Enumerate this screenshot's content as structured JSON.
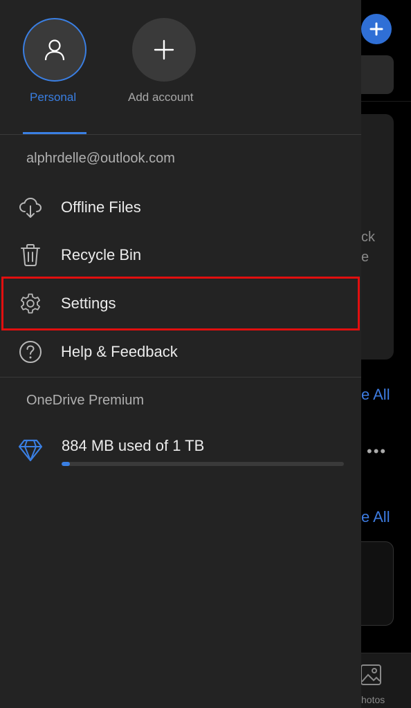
{
  "background": {
    "card_text_line1": "ck",
    "card_text_line2": "e",
    "see_all_1": "e All",
    "see_all_2": "e All",
    "more_dots": "•••",
    "tab_label": "hotos",
    "fab_icon": "plus-icon"
  },
  "accounts": [
    {
      "label": "Personal",
      "icon": "person-icon",
      "selected": true
    },
    {
      "label": "Add account",
      "icon": "plus-icon",
      "selected": false
    }
  ],
  "email": "alphrdelle@outlook.com",
  "menu": [
    {
      "label": "Offline Files",
      "icon": "cloud-download-icon"
    },
    {
      "label": "Recycle Bin",
      "icon": "trash-icon"
    },
    {
      "label": "Settings",
      "icon": "gear-icon",
      "highlighted": true
    },
    {
      "label": "Help & Feedback",
      "icon": "help-circle-icon"
    }
  ],
  "premium": {
    "title": "OneDrive Premium",
    "usage_text": "884 MB used of 1 TB",
    "used_fraction": 0.00086,
    "icon": "diamond-icon"
  },
  "colors": {
    "accent": "#3a7fe3",
    "highlight": "#e10f0f",
    "drawer_bg": "#232323"
  }
}
